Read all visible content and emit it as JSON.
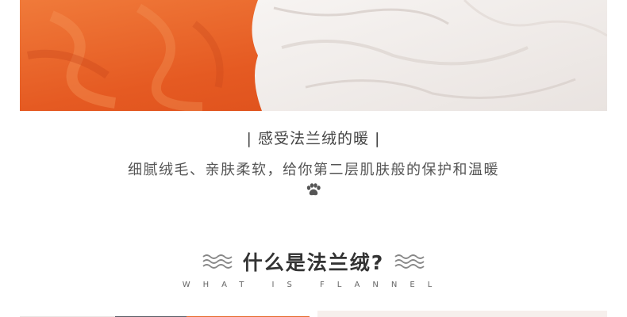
{
  "banner": {
    "tagline": "| 感受法兰绒的暖 |",
    "description": "细腻绒毛、亲肤柔软，给你第二层肌肤般的保护和温暖",
    "paw_icon": "paw-icon"
  },
  "section": {
    "heading": "什么是法兰绒?",
    "subheading": "WHAT IS FLANNEL",
    "decoration_icon": "wave-icon"
  },
  "colors": {
    "orange_fleece": "#e8622a",
    "white_fleece": "#f4f0ee",
    "text": "#444444"
  }
}
